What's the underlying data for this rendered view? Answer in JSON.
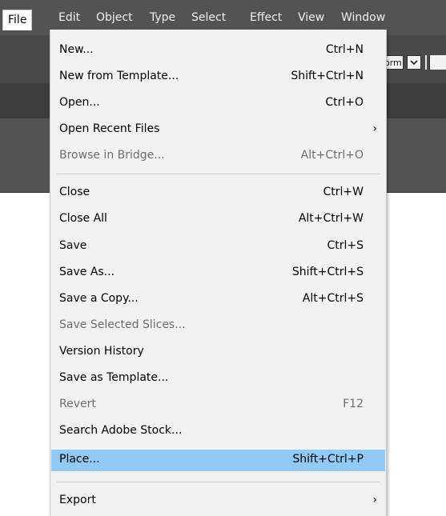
{
  "menubar": {
    "items": [
      {
        "label": "File",
        "active": true
      },
      {
        "label": "Edit"
      },
      {
        "label": "Object"
      },
      {
        "label": "Type"
      },
      {
        "label": "Select"
      },
      {
        "label": "Effect"
      },
      {
        "label": "View"
      },
      {
        "label": "Window"
      }
    ]
  },
  "control_bar": {
    "partial_field_text": "orm"
  },
  "file_menu": {
    "items": [
      {
        "label": "New...",
        "shortcut": "Ctrl+N",
        "enabled": true
      },
      {
        "label": "New from Template...",
        "shortcut": "Shift+Ctrl+N",
        "enabled": true
      },
      {
        "label": "Open...",
        "shortcut": "Ctrl+O",
        "enabled": true
      },
      {
        "label": "Open Recent Files",
        "shortcut": "",
        "submenu": true,
        "enabled": true
      },
      {
        "label": "Browse in Bridge...",
        "shortcut": "Alt+Ctrl+O",
        "enabled": false
      },
      {
        "label": "Close",
        "shortcut": "Ctrl+W",
        "enabled": true
      },
      {
        "label": "Close All",
        "shortcut": "Alt+Ctrl+W",
        "enabled": true
      },
      {
        "label": "Save",
        "shortcut": "Ctrl+S",
        "enabled": true
      },
      {
        "label": "Save As...",
        "shortcut": "Shift+Ctrl+S",
        "enabled": true
      },
      {
        "label": "Save a Copy...",
        "shortcut": "Alt+Ctrl+S",
        "enabled": true
      },
      {
        "label": "Save Selected Slices...",
        "shortcut": "",
        "enabled": false
      },
      {
        "label": "Version History",
        "shortcut": "",
        "enabled": true
      },
      {
        "label": "Save as Template...",
        "shortcut": "",
        "enabled": true
      },
      {
        "label": "Revert",
        "shortcut": "F12",
        "enabled": false
      },
      {
        "label": "Search Adobe Stock...",
        "shortcut": "",
        "enabled": true
      },
      {
        "label": "Place...",
        "shortcut": "Shift+Ctrl+P",
        "enabled": true,
        "highlighted": true
      },
      {
        "label": "Export",
        "shortcut": "",
        "submenu": true,
        "enabled": true
      }
    ]
  },
  "colors": {
    "menubar_bg": "#535353",
    "menu_bg": "#f2f2f2",
    "highlight": "#91c9f7",
    "disabled_text": "#6d6d6d"
  }
}
